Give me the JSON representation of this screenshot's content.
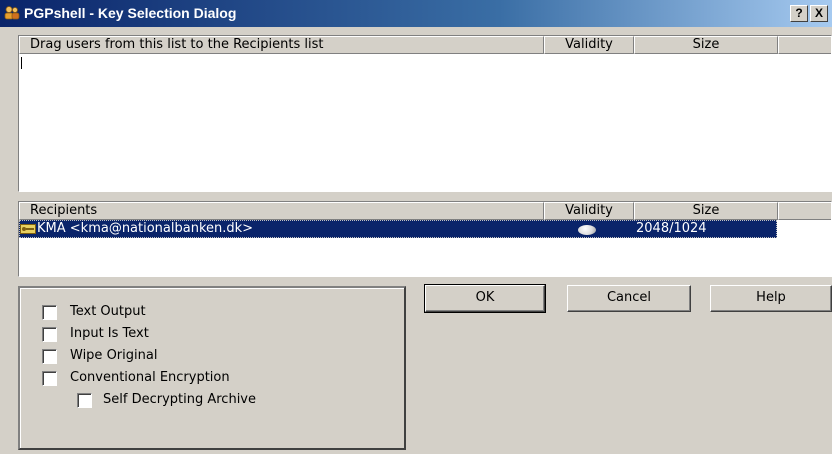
{
  "window": {
    "title": "PGPshell - Key Selection Dialog",
    "help_button": "?",
    "close_button": "X"
  },
  "keylist": {
    "columns": [
      "Drag users from this list to the Recipients list",
      "Validity",
      "Size"
    ],
    "rows": []
  },
  "recipients": {
    "columns": [
      "Recipients",
      "Validity",
      "Size"
    ],
    "rows": [
      {
        "name": "KMA <kma@nationalbanken.dk>",
        "validity": "valid",
        "size": "2048/1024",
        "selected": true
      }
    ]
  },
  "options": [
    {
      "label": "Text Output",
      "checked": false
    },
    {
      "label": "Input Is Text",
      "checked": false
    },
    {
      "label": "Wipe Original",
      "checked": false
    },
    {
      "label": "Conventional Encryption",
      "checked": false
    },
    {
      "label": "Self Decrypting Archive",
      "checked": false
    }
  ],
  "buttons": {
    "ok": "OK",
    "cancel": "Cancel",
    "help": "Help"
  },
  "colors": {
    "title_bar": "#0a246a",
    "face": "#d4d0c8",
    "selection": "#0a246a"
  }
}
